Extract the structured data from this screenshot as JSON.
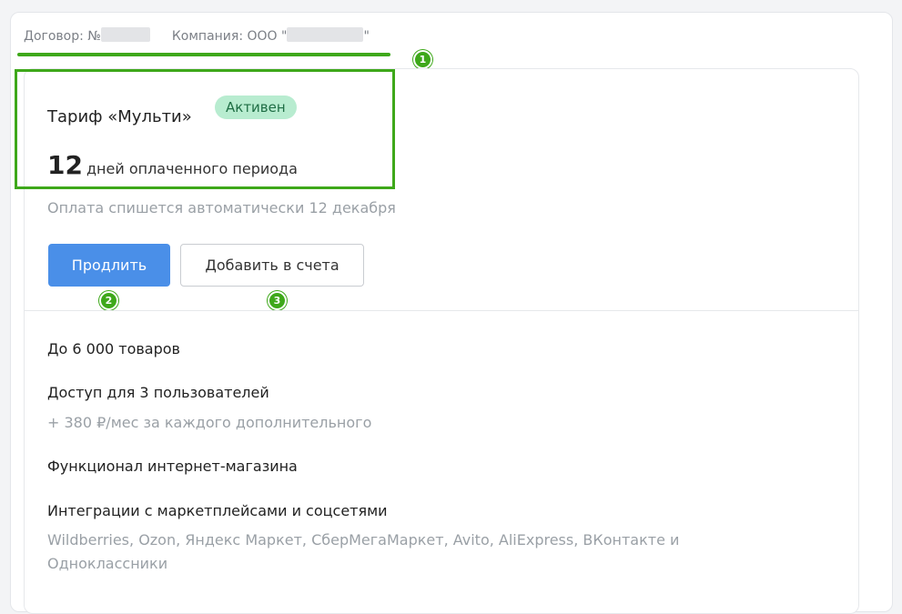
{
  "contract": {
    "label": "Договор: №",
    "company_label": "Компания: ООО \"",
    "company_suffix": "\""
  },
  "annotations": [
    "1",
    "2",
    "3"
  ],
  "tariff": {
    "title": "Тариф «Мульти»",
    "status": "Активен",
    "days": "12",
    "days_text": "дней оплаченного периода",
    "autopay_text": "Оплата спишется автоматически 12 декабря"
  },
  "buttons": {
    "extend": "Продлить",
    "add_to_bills": "Добавить в счета"
  },
  "features": [
    {
      "title": "До 6 000 товаров",
      "subtitle": ""
    },
    {
      "title": "Доступ для 3 пользователей",
      "subtitle": "+ 380 ₽/мес за каждого дополнительного"
    },
    {
      "title": "Функционал интернет-магазина",
      "subtitle": ""
    },
    {
      "title": "Интеграции с маркетплейсами и соцсетями",
      "subtitle": "Wildberries, Ozon, Яндекс Маркет, СберМегаМаркет, Avito, AliExpress, ВКонтакте и",
      "subtitle2": "Одноклассники"
    }
  ],
  "colors": {
    "highlight": "#3ea81a",
    "primary": "#4a8fe8",
    "status_bg": "#b8ecd0"
  }
}
